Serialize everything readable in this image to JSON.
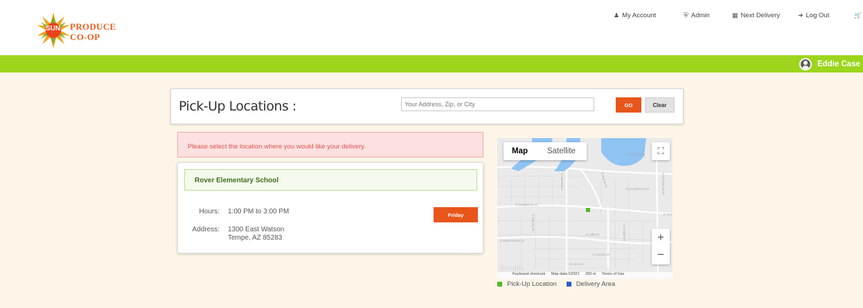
{
  "brand": {
    "sun": "SUN",
    "line1": "PRODUCE",
    "line2": "CO-OP"
  },
  "nav": [
    {
      "label": "My Account",
      "icon": "user-icon"
    },
    {
      "label": "Admin",
      "icon": "shield-icon"
    },
    {
      "label": "Next Delivery",
      "icon": "calendar-icon"
    },
    {
      "label": "Log Out",
      "icon": "logout-icon"
    }
  ],
  "cart_icon": "cart-icon",
  "user": {
    "name": "Eddie Case"
  },
  "colors": {
    "accent_green": "#9dd51d",
    "button_orange": "#e8561b",
    "page_bg": "#fdf5e8"
  },
  "search": {
    "title": "Pick-Up Locations :",
    "placeholder": "Your Address, Zip, or City",
    "value": "",
    "go_label": "GO",
    "clear_label": "Clear"
  },
  "alert": "Please select the location where you would like your delivery.",
  "location": {
    "name": "Rover Elementary School",
    "hours_label": "Hours:",
    "hours": "1:00 PM to 3:00 PM",
    "address_label": "Address:",
    "address_line1": "1300 East Watson",
    "address_line2": "Tempe, AZ 85283",
    "day_button": "Friday"
  },
  "map": {
    "type_map": "Map",
    "type_satellite": "Satellite",
    "streets": [
      "E Edgewater",
      "S McClintock Dr",
      "E Southshore Dr",
      "E Magdalena Dr",
      "E Westchester Dr",
      "E Julie Dr",
      "E Gemini Dr",
      "E Libra Dr",
      "S Stanley Pl",
      "S Juniper St",
      "S Lakeshore",
      "S Marne Dr",
      "E Wat"
    ],
    "zoom_in": "+",
    "zoom_out": "−",
    "footer": {
      "shortcuts": "Keyboard shortcuts",
      "data": "Map data ©2021",
      "scale": "200 m",
      "terms": "Terms of Use"
    },
    "google": "Google"
  },
  "legend": [
    {
      "label": "Pick-Up Location",
      "color": "#55b82a"
    },
    {
      "label": "Delivery Area",
      "color": "#2b5fc7"
    }
  ]
}
